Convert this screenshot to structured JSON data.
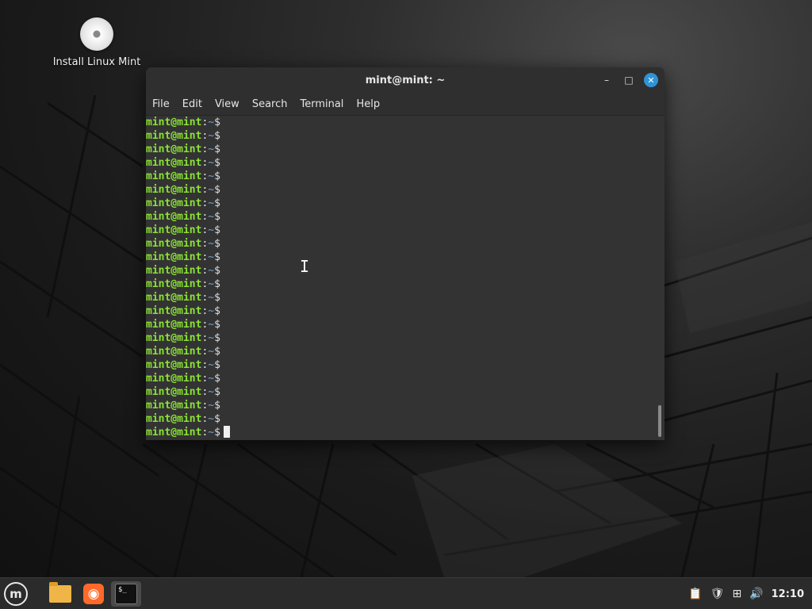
{
  "desktop": {
    "icons": [
      {
        "label": "Install Linux Mint",
        "icon": "disc-icon"
      }
    ]
  },
  "window": {
    "title": "mint@mint: ~",
    "controls": {
      "minimize": "–",
      "maximize": "□",
      "close": "✕"
    },
    "menu": [
      "File",
      "Edit",
      "View",
      "Search",
      "Terminal",
      "Help"
    ]
  },
  "terminal": {
    "prompt_user": "mint@mint",
    "prompt_sep": ":",
    "prompt_path": "~",
    "prompt_symbol": "$",
    "line_count": 24,
    "colors": {
      "user": "#8ae234",
      "background": "#333333",
      "text": "#e0e0e0"
    }
  },
  "taskbar": {
    "menu_icon": "linux-mint-logo-icon",
    "apps": [
      "files-icon",
      "firefox-icon",
      "terminal-icon"
    ],
    "terminal_icon_text": "$_",
    "tray": [
      "clipboard-icon",
      "shield-update-icon",
      "network-icon",
      "volume-icon"
    ],
    "clock": "12:10"
  }
}
